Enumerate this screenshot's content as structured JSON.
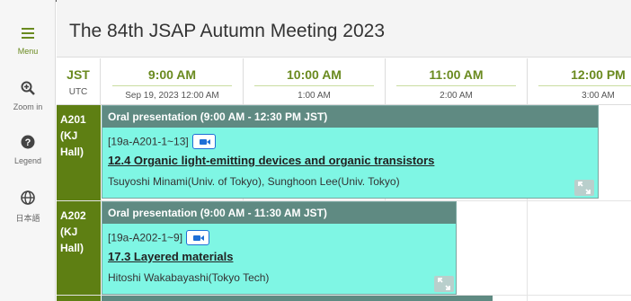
{
  "sidebar": {
    "menu": {
      "label": "Menu",
      "icon": "hamburger-icon"
    },
    "zoom": {
      "label": "Zoom in",
      "icon": "zoom-in-icon"
    },
    "legend": {
      "label": "Legend",
      "icon": "help-circle-icon"
    },
    "language": {
      "label": "日本語",
      "icon": "globe-icon"
    }
  },
  "header": {
    "title": "The 84th JSAP Autumn Meeting 2023"
  },
  "timezones": {
    "primary": "JST",
    "secondary": "UTC"
  },
  "hours": [
    {
      "jst": "9:00 AM",
      "utc": "Sep 19, 2023 12:00 AM"
    },
    {
      "jst": "10:00 AM",
      "utc": "1:00 AM"
    },
    {
      "jst": "11:00 AM",
      "utc": "2:00 AM"
    },
    {
      "jst": "12:00 PM",
      "utc": "3:00 AM"
    }
  ],
  "rooms": [
    {
      "name_lines": [
        "A201",
        "(KJ",
        "Hall)"
      ],
      "session": {
        "header": "Oral presentation  (9:00 AM - 12:30 PM JST)",
        "code": "[19a-A201-1~13]",
        "title": "12.4 Organic light-emitting devices and organic transistors",
        "chairs": "Tsuyoshi Minami(Univ. of Tokyo), Sunghoon Lee(Univ. Tokyo)"
      }
    },
    {
      "name_lines": [
        "A202",
        "(KJ",
        "Hall)"
      ],
      "session": {
        "header": "Oral presentation  (9:00 AM - 11:30 AM JST)",
        "code": "[19a-A202-1~9]",
        "title": "17.3 Layered materials",
        "chairs": "Hitoshi Wakabayashi(Tokyo Tech)"
      }
    }
  ],
  "colors": {
    "accent_green": "#6a8a1f",
    "room_green": "#5e7f13",
    "session_fill": "#7ff6e4",
    "session_header": "#5f8a82",
    "video_blue": "#1e6fd6"
  }
}
